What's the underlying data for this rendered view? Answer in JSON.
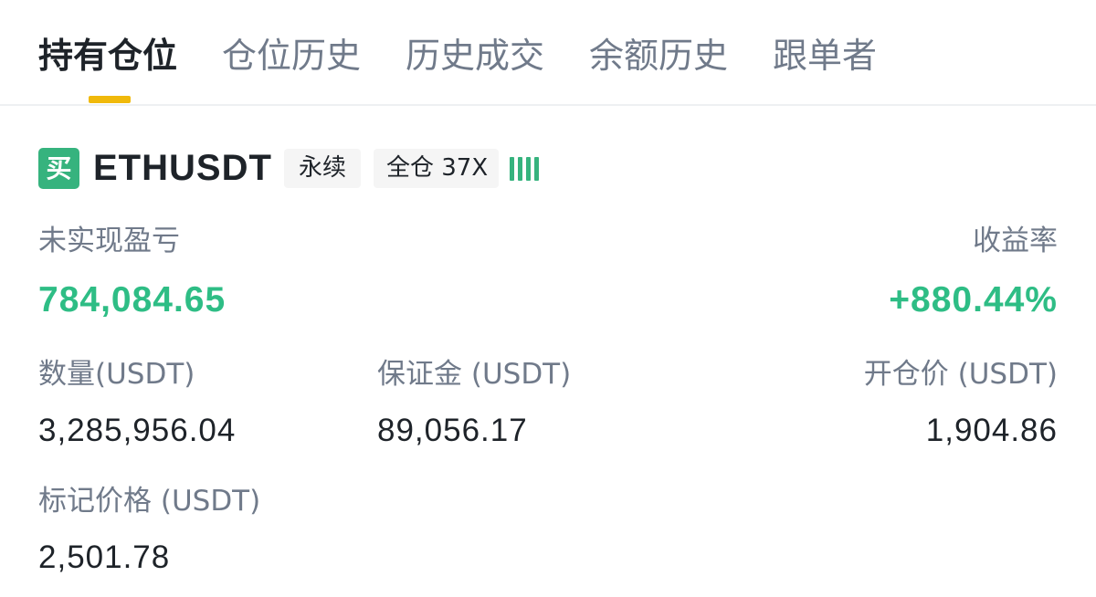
{
  "tabs": [
    {
      "label": "持有仓位",
      "active": true
    },
    {
      "label": "仓位历史",
      "active": false
    },
    {
      "label": "历史成交",
      "active": false
    },
    {
      "label": "余额历史",
      "active": false
    },
    {
      "label": "跟单者",
      "active": false
    }
  ],
  "position": {
    "side_badge": "买",
    "symbol": "ETHUSDT",
    "contract_type": "永续",
    "margin_leverage": "全仓 37X",
    "adl_indicator": "adl-bars-icon",
    "unrealized_pnl_label": "未实现盈亏",
    "unrealized_pnl_value": "784,084.65",
    "roe_label": "收益率",
    "roe_value": "+880.44%",
    "size_label": "数量(USDT)",
    "size_value": "3,285,956.04",
    "margin_label": "保证金 (USDT)",
    "margin_value": "89,056.17",
    "entry_price_label": "开仓价 (USDT)",
    "entry_price_value": "1,904.86",
    "mark_price_label": "标记价格 (USDT)",
    "mark_price_value": "2,501.78"
  },
  "colors": {
    "accent": "#f0b90b",
    "positive": "#2ebd85",
    "buy_badge": "#36b37e",
    "text_primary": "#1e2329",
    "text_secondary": "#707a8a"
  }
}
